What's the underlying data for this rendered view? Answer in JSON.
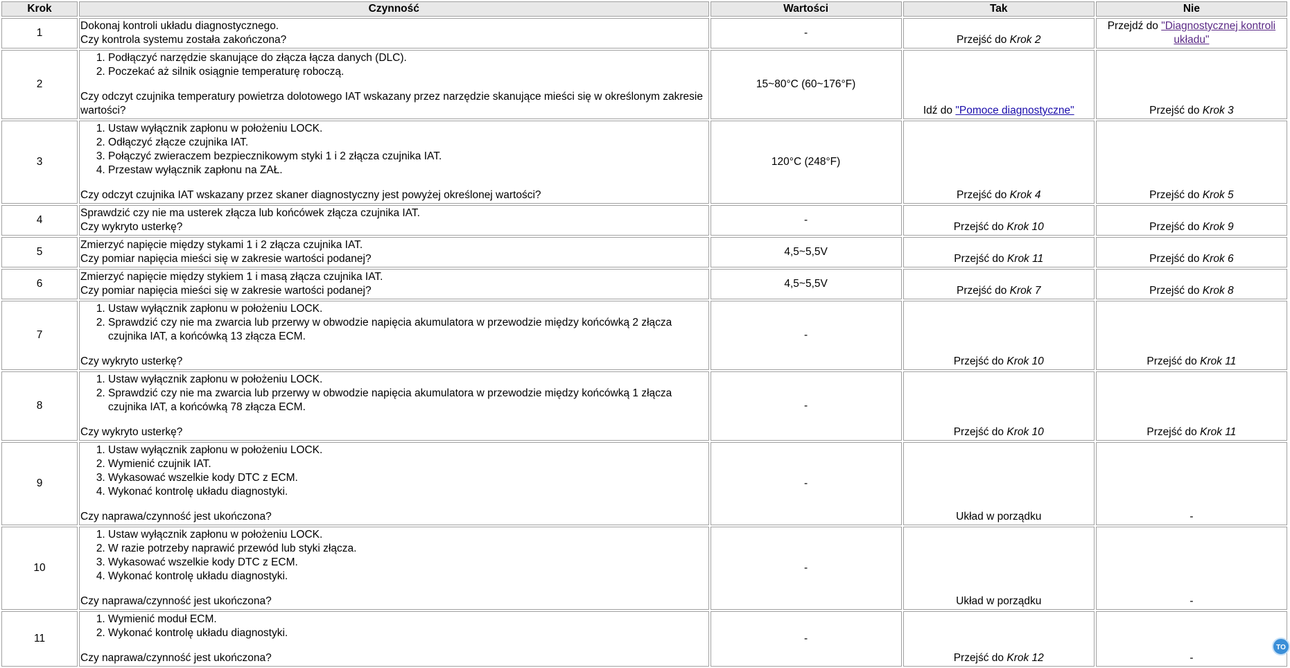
{
  "headers": {
    "krok": "Krok",
    "czynnosc": "Czynność",
    "wartosci": "Wartości",
    "tak": "Tak",
    "nie": "Nie"
  },
  "goto": "Przejść do",
  "krok_word": "Krok",
  "rows": [
    {
      "krok": "1",
      "lines": [
        "Dokonaj kontroli układu diagnostycznego."
      ],
      "question": "Czy kontrola systemu została zakończona?",
      "value": "-",
      "tak": {
        "pre": "Przejść do",
        "ref": "Krok 2"
      },
      "nie": {
        "pre": "Przejdź do",
        "link": "\"Diagnostycznej kontroli układu\""
      }
    },
    {
      "krok": "2",
      "items": [
        "Podłączyć narzędzie skanujące do złącza łącza danych (DLC).",
        "Poczekać aż silnik osiągnie temperaturę roboczą."
      ],
      "question": "Czy odczyt czujnika temperatury powietrza dolotowego IAT wskazany przez narzędzie skanujące mieści się w określonym zakresie wartości?",
      "value": "15~80°C (60~176°F)",
      "tak": {
        "pre": "Idź do",
        "link": "\"Pomoce diagnostyczne\""
      },
      "nie": {
        "pre": "Przejść do",
        "ref": "Krok 3"
      }
    },
    {
      "krok": "3",
      "items": [
        "Ustaw wyłącznik zapłonu w położeniu LOCK.",
        "Odłączyć złącze czujnika IAT.",
        "Połączyć zwieraczem bezpiecznikowym styki 1 i 2 złącza czujnika IAT.",
        "Przestaw wyłącznik zapłonu na ZAŁ."
      ],
      "question": "Czy odczyt czujnika IAT wskazany przez skaner diagnostyczny jest powyżej określonej wartości?",
      "value": "120°C (248°F)",
      "tak": {
        "pre": "Przejść do",
        "ref": "Krok 4"
      },
      "nie": {
        "pre": "Przejść do",
        "ref": "Krok 5"
      }
    },
    {
      "krok": "4",
      "lines": [
        "Sprawdzić czy nie ma usterek złącza lub końcówek złącza czujnika IAT."
      ],
      "question": "Czy wykryto usterkę?",
      "value": "-",
      "tak": {
        "pre": "Przejść do",
        "ref": "Krok 10"
      },
      "nie": {
        "pre": "Przejść do",
        "ref": "Krok 9"
      }
    },
    {
      "krok": "5",
      "lines": [
        "Zmierzyć napięcie między stykami 1 i 2 złącza czujnika IAT."
      ],
      "question": "Czy pomiar napięcia mieści się w zakresie wartości podanej?",
      "value": "4,5~5,5V",
      "tak": {
        "pre": "Przejść do",
        "ref": "Krok 11"
      },
      "nie": {
        "pre": "Przejść do",
        "ref": "Krok 6"
      }
    },
    {
      "krok": "6",
      "lines": [
        "Zmierzyć napięcie między stykiem 1 i masą złącza czujnika IAT."
      ],
      "question": "Czy pomiar napięcia mieści się w zakresie wartości podanej?",
      "value": "4,5~5,5V",
      "tak": {
        "pre": "Przejść do",
        "ref": "Krok 7"
      },
      "nie": {
        "pre": "Przejść do",
        "ref": "Krok 8"
      }
    },
    {
      "krok": "7",
      "items": [
        "Ustaw wyłącznik zapłonu w położeniu LOCK.",
        "Sprawdzić czy nie ma zwarcia lub przerwy w obwodzie napięcia akumulatora w przewodzie między końcówką 2 złącza czujnika IAT, a końcówką 13 złącza ECM."
      ],
      "question": "Czy wykryto usterkę?",
      "value": "-",
      "tak": {
        "pre": "Przejść do",
        "ref": "Krok 10"
      },
      "nie": {
        "pre": "Przejść do",
        "ref": "Krok 11"
      }
    },
    {
      "krok": "8",
      "items": [
        "Ustaw wyłącznik zapłonu w położeniu LOCK.",
        "Sprawdzić czy nie ma zwarcia lub przerwy w obwodzie napięcia akumulatora w przewodzie między końcówką 1 złącza czujnika IAT, a końcówką 78 złącza ECM."
      ],
      "question": "Czy wykryto usterkę?",
      "value": "-",
      "tak": {
        "pre": "Przejść do",
        "ref": "Krok 10"
      },
      "nie": {
        "pre": "Przejść do",
        "ref": "Krok 11"
      }
    },
    {
      "krok": "9",
      "items": [
        "Ustaw wyłącznik zapłonu w położeniu LOCK.",
        "Wymienić czujnik IAT.",
        "Wykasować wszelkie kody DTC z ECM.",
        "Wykonać kontrolę układu diagnostyki."
      ],
      "question": "Czy naprawa/czynność jest ukończona?",
      "value": "-",
      "tak": {
        "text": "Układ w porządku"
      },
      "nie": {
        "text": "-"
      }
    },
    {
      "krok": "10",
      "items": [
        "Ustaw wyłącznik zapłonu w położeniu LOCK.",
        "W razie potrzeby naprawić przewód lub styki złącza.",
        "Wykasować wszelkie kody DTC z ECM.",
        "Wykonać kontrolę układu diagnostyki."
      ],
      "question": "Czy naprawa/czynność jest ukończona?",
      "value": "-",
      "tak": {
        "text": "Układ w porządku"
      },
      "nie": {
        "text": "-"
      }
    },
    {
      "krok": "11",
      "items": [
        "Wymienić moduł ECM.",
        "Wykonać kontrolę układu diagnostyki."
      ],
      "question": "Czy naprawa/czynność jest ukończona?",
      "value": "-",
      "tak": {
        "pre": "Przejść do",
        "ref": "Krok 12"
      },
      "nie": {
        "text": "-"
      }
    }
  ],
  "to_top_label": "TO"
}
